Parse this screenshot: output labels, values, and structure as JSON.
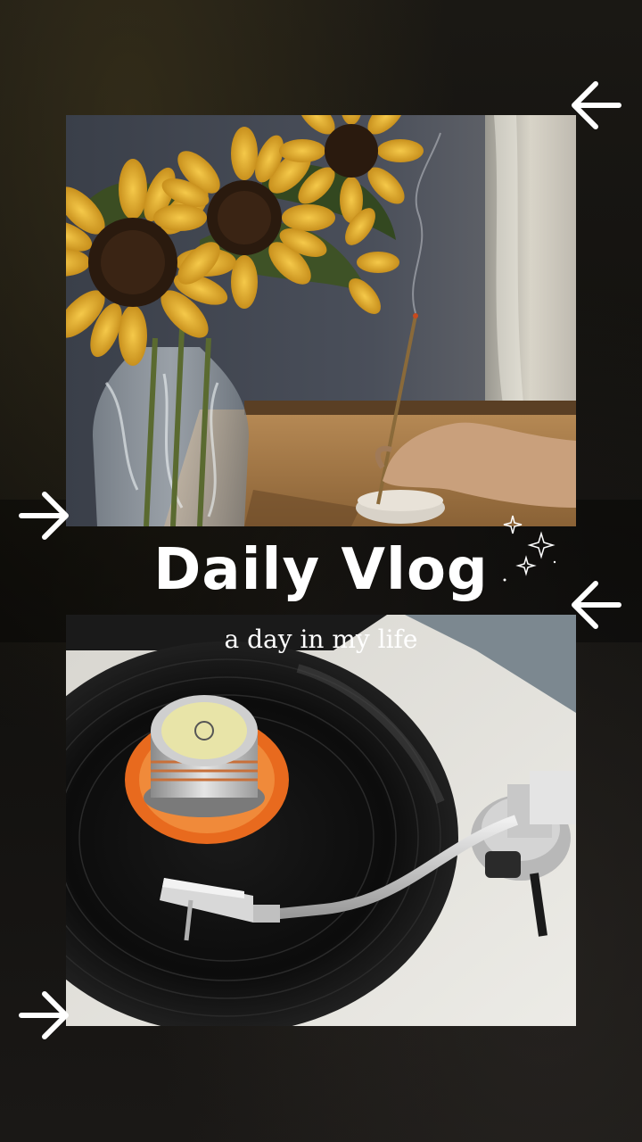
{
  "title": "Daily Vlog",
  "subtitle": "a day in my life",
  "icons": {
    "arrow_left": "arrow-left-icon",
    "arrow_right": "arrow-right-icon",
    "sparkle": "sparkle-icon"
  },
  "colors": {
    "background": "#151310",
    "text": "#ffffff",
    "sunflower_yellow": "#e8b53a",
    "vinyl_orange": "#e86a1e"
  }
}
